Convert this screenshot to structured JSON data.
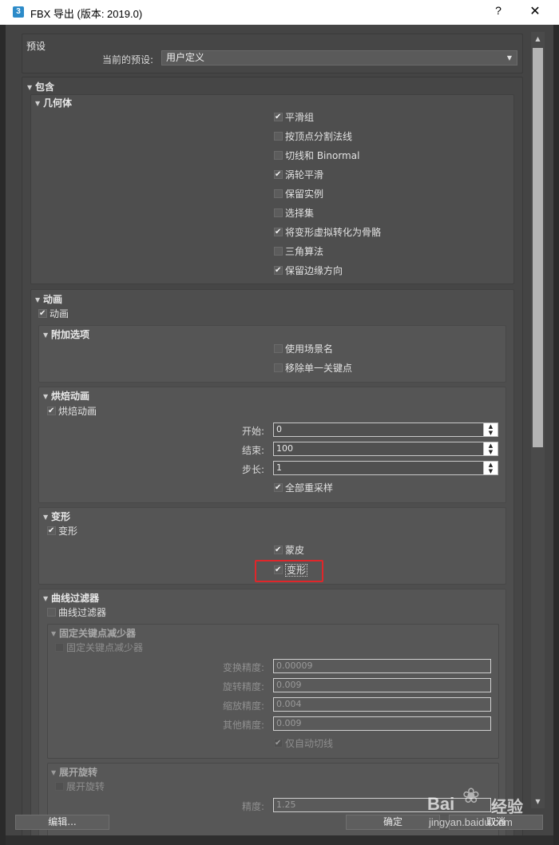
{
  "window": {
    "title": "FBX 导出 (版本: 2019.0)",
    "app_icon": "3",
    "help_label": "?",
    "close_label": "✕"
  },
  "preset": {
    "header": "预设",
    "label": "当前的预设:",
    "value": "用户定义"
  },
  "include": {
    "header": "包含",
    "geometry": {
      "header": "几何体",
      "items": [
        {
          "label": "平滑组",
          "checked": true
        },
        {
          "label": "按顶点分割法线",
          "checked": false
        },
        {
          "label": "切线和 Binormal",
          "checked": false
        },
        {
          "label": "涡轮平滑",
          "checked": true
        },
        {
          "label": "保留实例",
          "checked": false
        },
        {
          "label": "选择集",
          "checked": false
        },
        {
          "label": "将变形虚拟转化为骨骼",
          "checked": true
        },
        {
          "label": "三角算法",
          "checked": false
        },
        {
          "label": "保留边缘方向",
          "checked": true
        }
      ]
    },
    "animation": {
      "header": "动画",
      "checkbox_label": "动画",
      "extra": {
        "header": "附加选项",
        "items": [
          {
            "label": "使用场景名",
            "checked": false
          },
          {
            "label": "移除单一关键点",
            "checked": false
          }
        ]
      },
      "bake": {
        "header": "烘焙动画",
        "checkbox_label": "烘焙动画",
        "start_label": "开始:",
        "start_value": "0",
        "end_label": "结束:",
        "end_value": "100",
        "step_label": "步长:",
        "step_value": "1",
        "resample_label": "全部重采样"
      },
      "deform": {
        "header": "变形",
        "checkbox_label": "变形",
        "skin_label": "蒙皮",
        "morph_label": "变形"
      },
      "curve_filters": {
        "header": "曲线过滤器",
        "checkbox_label": "曲线过滤器",
        "key_reducer": {
          "header": "固定关键点减少器",
          "checkbox_label": "固定关键点减少器",
          "translation_label": "变换精度:",
          "translation_value": "0.00009",
          "rotation_label": "旋转精度:",
          "rotation_value": "0.009",
          "scale_label": "缩放精度:",
          "scale_value": "0.004",
          "other_label": "其他精度:",
          "other_value": "0.009",
          "auto_tangents_label": "仅自动切线"
        },
        "unroll": {
          "header": "展开旋转",
          "checkbox_label": "展开旋转",
          "precision_label": "精度:",
          "precision_value": "1.25"
        }
      }
    }
  },
  "buttons": {
    "edit": "编辑...",
    "ok": "确定",
    "cancel": "取消"
  },
  "watermark": {
    "brand_a": "Bai",
    "brand_b": "经验",
    "url": "jingyan.baidu.com"
  },
  "colors": {
    "highlight": "#e0262a",
    "panel": "#464646",
    "background": "#3b3b3b"
  }
}
